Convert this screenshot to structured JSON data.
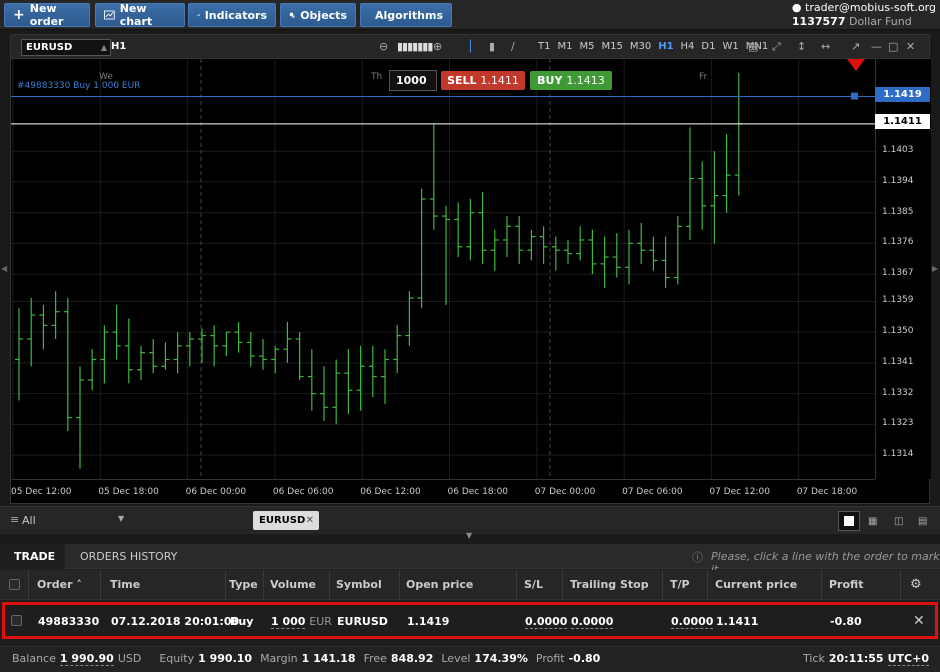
{
  "toolbar": {
    "new_order": "New order",
    "new_chart": "New chart",
    "indicators": "Indicators",
    "objects": "Objects",
    "algorithms": "Algorithms"
  },
  "account": {
    "user": "trader@mobius-soft.org",
    "id": "1137577",
    "fund": "Dollar Fund"
  },
  "chart": {
    "symbol": "EURUSD",
    "timeframe": "H1",
    "timeframes": [
      "T1",
      "M1",
      "M5",
      "M15",
      "M30",
      "H1",
      "H4",
      "D1",
      "W1",
      "MN1"
    ],
    "active_timeframe": "H1",
    "order_line_label": "#49883330 Buy 1 000 EUR",
    "volume": "1000",
    "sell_label": "SELL",
    "sell_price": "1.1411",
    "buy_label": "BUY",
    "buy_price": "1.1413",
    "day_labels": [
      "We",
      "Th",
      "Fr"
    ],
    "open_price_tag": "1.1419",
    "current_price_tag": "1.1411",
    "y_labels": [
      "1.1403",
      "1.1394",
      "1.1385",
      "1.1376",
      "1.1367",
      "1.1359",
      "1.1350",
      "1.1341",
      "1.1332",
      "1.1323",
      "1.1314"
    ],
    "x_labels": [
      "05 Dec 12:00",
      "05 Dec 18:00",
      "06 Dec 00:00",
      "06 Dec 06:00",
      "06 Dec 12:00",
      "06 Dec 18:00",
      "07 Dec 00:00",
      "07 Dec 06:00",
      "07 Dec 12:00",
      "07 Dec 18:00"
    ],
    "colors": {
      "bull": "#3fb83f",
      "order_line": "#2d6bc4",
      "current_line": "#ffffff",
      "sell": "#c0392b",
      "buy": "#3f9a35"
    }
  },
  "chart_data": {
    "type": "bar",
    "title": "EURUSD H1",
    "series": [
      {
        "name": "EURUSD",
        "ohlc": [
          [
            1.1342,
            1.1357,
            1.133,
            1.1348
          ],
          [
            1.1348,
            1.136,
            1.134,
            1.1355
          ],
          [
            1.1355,
            1.1358,
            1.1345,
            1.1352
          ],
          [
            1.1352,
            1.1362,
            1.1348,
            1.1356
          ],
          [
            1.1356,
            1.136,
            1.1321,
            1.1325
          ],
          [
            1.1325,
            1.134,
            1.131,
            1.1336
          ],
          [
            1.1336,
            1.1345,
            1.1333,
            1.1342
          ],
          [
            1.1342,
            1.1352,
            1.1335,
            1.135
          ],
          [
            1.135,
            1.1358,
            1.1342,
            1.1346
          ],
          [
            1.1346,
            1.1354,
            1.1335,
            1.1339
          ],
          [
            1.1339,
            1.1346,
            1.1336,
            1.1344
          ],
          [
            1.1344,
            1.1348,
            1.1338,
            1.134
          ],
          [
            1.134,
            1.1347,
            1.1339,
            1.1342
          ],
          [
            1.1342,
            1.135,
            1.1338,
            1.1346
          ],
          [
            1.1346,
            1.135,
            1.134,
            1.1348
          ],
          [
            1.1348,
            1.1351,
            1.1341,
            1.1349
          ],
          [
            1.1349,
            1.1352,
            1.134,
            1.1346
          ],
          [
            1.1346,
            1.135,
            1.1343,
            1.135
          ],
          [
            1.135,
            1.1353,
            1.1344,
            1.1347
          ],
          [
            1.1347,
            1.135,
            1.134,
            1.1343
          ],
          [
            1.1343,
            1.1348,
            1.1339,
            1.1342
          ],
          [
            1.1342,
            1.1346,
            1.1338,
            1.1345
          ],
          [
            1.1345,
            1.1353,
            1.1341,
            1.1348
          ],
          [
            1.1348,
            1.135,
            1.1336,
            1.1337
          ],
          [
            1.1337,
            1.1345,
            1.1327,
            1.1332
          ],
          [
            1.1332,
            1.134,
            1.1324,
            1.1328
          ],
          [
            1.1328,
            1.1342,
            1.1323,
            1.1338
          ],
          [
            1.1338,
            1.1345,
            1.1326,
            1.1333
          ],
          [
            1.1333,
            1.1346,
            1.1327,
            1.134
          ],
          [
            1.134,
            1.1346,
            1.1331,
            1.1337
          ],
          [
            1.1337,
            1.1345,
            1.1329,
            1.1342
          ],
          [
            1.1342,
            1.1352,
            1.1338,
            1.1349
          ],
          [
            1.1349,
            1.1362,
            1.1346,
            1.136
          ],
          [
            1.136,
            1.1392,
            1.1357,
            1.1389
          ],
          [
            1.1389,
            1.1411,
            1.138,
            1.1384
          ],
          [
            1.1384,
            1.1387,
            1.1358,
            1.1383
          ],
          [
            1.1383,
            1.1388,
            1.1372,
            1.1375
          ],
          [
            1.1375,
            1.1389,
            1.1371,
            1.1385
          ],
          [
            1.1385,
            1.1391,
            1.137,
            1.1374
          ],
          [
            1.1374,
            1.138,
            1.1368,
            1.1377
          ],
          [
            1.1377,
            1.1384,
            1.1372,
            1.1381
          ],
          [
            1.1381,
            1.1384,
            1.137,
            1.1374
          ],
          [
            1.1374,
            1.138,
            1.1371,
            1.1378
          ],
          [
            1.1378,
            1.1381,
            1.137,
            1.1375
          ],
          [
            1.1375,
            1.1378,
            1.1368,
            1.1374
          ],
          [
            1.1374,
            1.1377,
            1.137,
            1.1373
          ],
          [
            1.1373,
            1.1381,
            1.1371,
            1.1377
          ],
          [
            1.1377,
            1.138,
            1.1367,
            1.137
          ],
          [
            1.137,
            1.1378,
            1.1363,
            1.1372
          ],
          [
            1.1372,
            1.1379,
            1.1366,
            1.1369
          ],
          [
            1.1369,
            1.138,
            1.1364,
            1.1376
          ],
          [
            1.1376,
            1.1382,
            1.137,
            1.1374
          ],
          [
            1.1374,
            1.1378,
            1.1368,
            1.1371
          ],
          [
            1.1371,
            1.1378,
            1.1363,
            1.1366
          ],
          [
            1.1366,
            1.1384,
            1.1364,
            1.1381
          ],
          [
            1.1381,
            1.141,
            1.1377,
            1.1395
          ],
          [
            1.1395,
            1.14,
            1.138,
            1.1387
          ],
          [
            1.1387,
            1.1403,
            1.1376,
            1.139
          ],
          [
            1.139,
            1.1408,
            1.1385,
            1.1396
          ],
          [
            1.1396,
            1.1426,
            1.139,
            1.1411
          ]
        ]
      }
    ],
    "x_labels": [
      "05 Dec 12:00",
      "05 Dec 18:00",
      "06 Dec 00:00",
      "06 Dec 06:00",
      "06 Dec 12:00",
      "06 Dec 18:00",
      "07 Dec 00:00",
      "07 Dec 06:00",
      "07 Dec 12:00",
      "07 Dec 18:00"
    ],
    "ylim": [
      1.1307,
      1.143
    ],
    "ylabel": "",
    "xlabel": ""
  },
  "bottom_tabs": {
    "filter": "All",
    "chart_tab": "EURUSD"
  },
  "panel": {
    "tab_trade": "TRADE",
    "tab_history": "ORDERS HISTORY",
    "hint": "Please, click a line with the order to mark it",
    "columns": [
      "Order",
      "Time",
      "Type",
      "Volume",
      "Symbol",
      "Open price",
      "S/L",
      "Trailing Stop",
      "T/P",
      "Current price",
      "Profit"
    ],
    "row": {
      "order": "49883330",
      "time": "07.12.2018 20:01:00",
      "type": "Buy",
      "volume": "1 000",
      "volume_unit": "EUR",
      "symbol": "EURUSD",
      "open_price": "1.1419",
      "sl": "0.0000",
      "trailing_stop": "0.0000",
      "tp": "0.0000",
      "current_price": "1.1411",
      "profit": "-0.80"
    }
  },
  "status": {
    "balance_label": "Balance",
    "balance": "1 990.90",
    "balance_currency": "USD",
    "equity_label": "Equity",
    "equity": "1 990.10",
    "margin_label": "Margin",
    "margin": "1 141.18",
    "free_label": "Free",
    "free": "848.92",
    "level_label": "Level",
    "level": "174.39%",
    "profit_label": "Profit",
    "profit": "-0.80",
    "tick_label": "Tick",
    "tick": "20:11:55",
    "tz": "UTC+0"
  }
}
